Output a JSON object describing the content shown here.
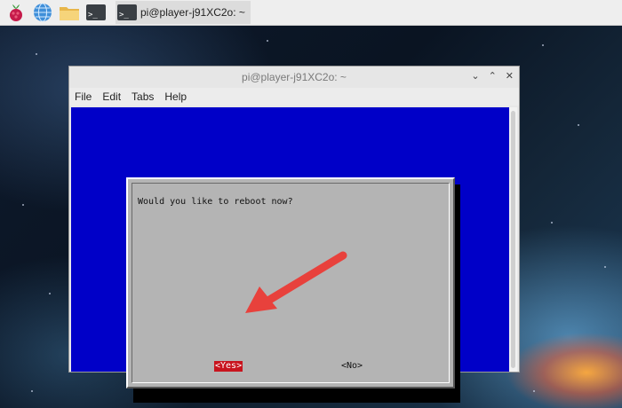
{
  "taskbar": {
    "icons": [
      "raspberry-menu-icon",
      "web-browser-icon",
      "file-manager-icon",
      "terminal-icon"
    ],
    "terminal_glyph": ">_",
    "task_label": "pi@player-j91XC2o: ~"
  },
  "window": {
    "title": "pi@player-j91XC2o: ~",
    "controls": [
      "⌄",
      "⌃",
      "✕"
    ],
    "menu": [
      "File",
      "Edit",
      "Tabs",
      "Help"
    ]
  },
  "dialog": {
    "question": "Would you like to reboot now?",
    "yes_label": "<Yes>",
    "no_label": "<No>",
    "selected": "<Yes>"
  },
  "colors": {
    "terminal_bg": "#0000c8",
    "dialog_bg": "#b4b4b4",
    "selected_button_bg": "#c8141e",
    "annotation_arrow": "#e8413c"
  }
}
